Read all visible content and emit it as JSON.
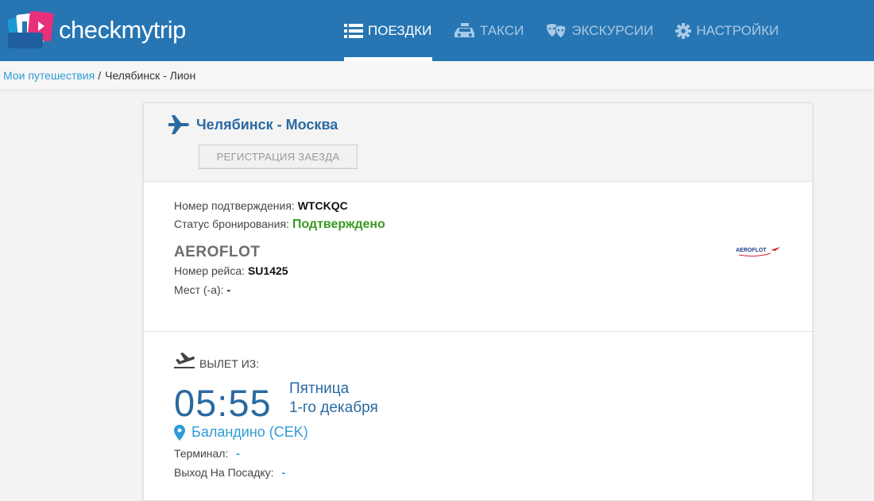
{
  "app": {
    "logo_text": "checkmytrip"
  },
  "nav": {
    "tabs": [
      {
        "label": "ПОЕЗДКИ",
        "icon": "list-icon",
        "active": true
      },
      {
        "label": "ТАКСИ",
        "icon": "taxi-icon",
        "active": false
      },
      {
        "label": "ЭКСКУРСИИ",
        "icon": "theater-masks-icon",
        "active": false
      },
      {
        "label": "НАСТРОЙКИ",
        "icon": "gear-icon",
        "active": false
      }
    ]
  },
  "breadcrumb": {
    "parent": "Мои путешествия",
    "separator": "/",
    "current": "Челябинск - Лион"
  },
  "segment": {
    "title": "Челябинск - Москва",
    "checkin_label": "РЕГИСТРАЦИЯ ЗАЕЗДА",
    "confirmation_label": "Номер подтверждения:",
    "confirmation_value": "WTCKQC",
    "status_label": "Статус бронирования:",
    "status_value": "Подтверждено",
    "airline": "AEROFLOT",
    "airline_logo_text": "AEROFLOT",
    "flight_label": "Номер рейса:",
    "flight_value": "SU1425",
    "seats_label": "Мест (-а):",
    "seats_value": "-"
  },
  "departure": {
    "label": "ВЫЛЕТ ИЗ:",
    "time": "05:55",
    "weekday": "Пятница",
    "date": "1-го декабря",
    "airport": "Баландино (CEK)",
    "terminal_label": "Терминал:",
    "terminal_value": "-",
    "gate_label": "Выход На Посадку:",
    "gate_value": "-"
  },
  "colors": {
    "header": "#2776b3",
    "accent": "#2a6aa1",
    "link": "#2f9bd6",
    "confirmed": "#3a9a22"
  }
}
